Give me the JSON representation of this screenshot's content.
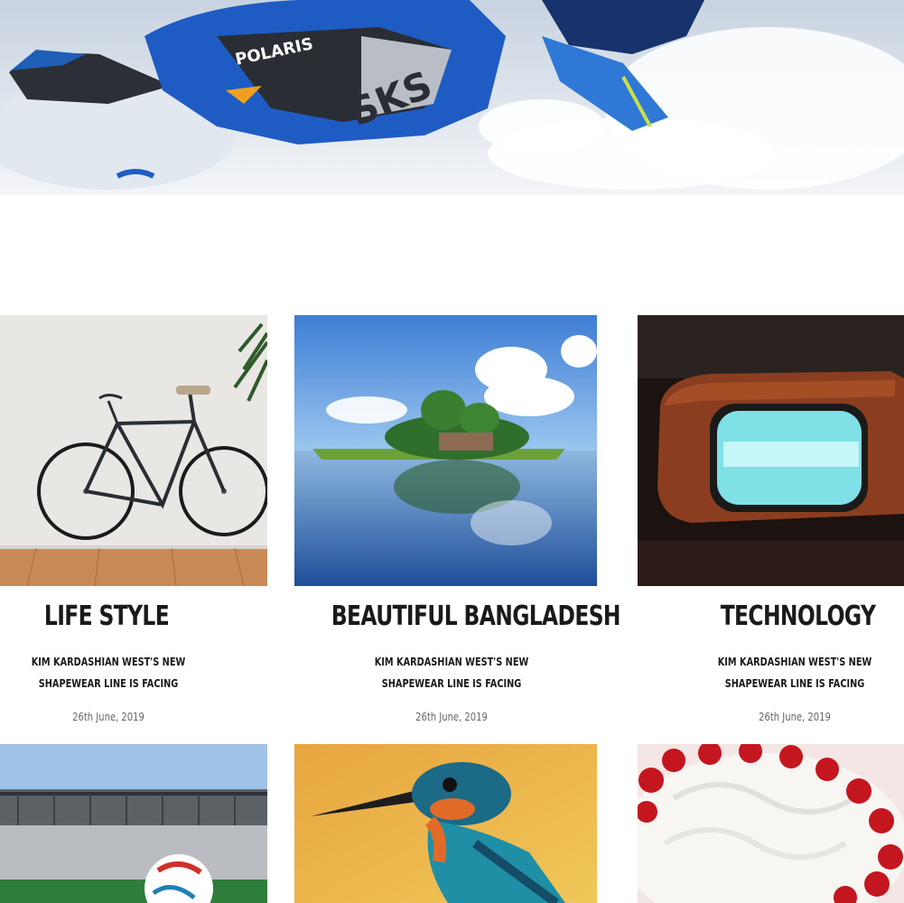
{
  "hero": {
    "alt": "snowmobile",
    "brand": "POLARIS",
    "model": "SKS"
  },
  "posts": [
    {
      "title": "LIFE STYLE",
      "excerpt_line1": "KIM KARDASHIAN WEST'S NEW",
      "excerpt_line2": "SHAPEWEAR LINE IS FACING",
      "date": "26th June, 2019"
    },
    {
      "title": "BEAUTIFUL BANGLADESH",
      "excerpt_line1": "KIM KARDASHIAN WEST'S NEW",
      "excerpt_line2": "SHAPEWEAR LINE IS FACING",
      "date": "26th June, 2019"
    },
    {
      "title": "TECHNOLOGY",
      "excerpt_line1": "KIM KARDASHIAN WEST'S NEW",
      "excerpt_line2": "SHAPEWEAR LINE IS FACING",
      "date": "26th June, 2019"
    },
    {
      "image": "stadium-football"
    },
    {
      "image": "kingfisher"
    },
    {
      "image": "strawberry-cake"
    }
  ]
}
